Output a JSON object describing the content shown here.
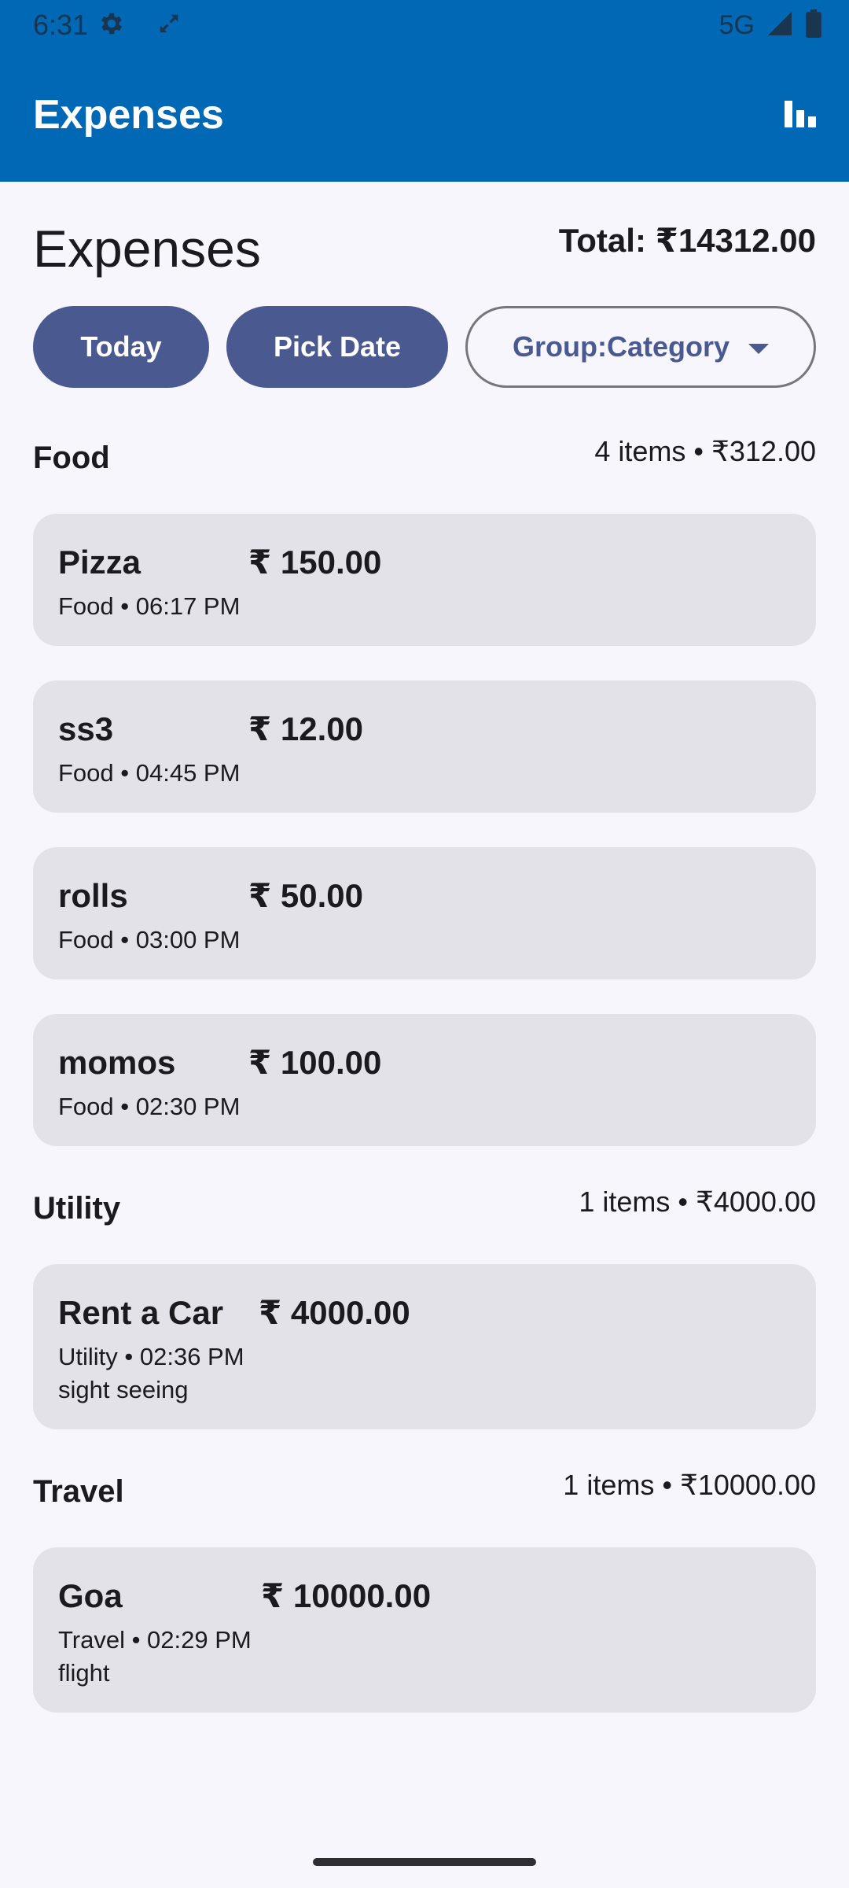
{
  "status_bar": {
    "time": "6:31",
    "network": "5G",
    "icons": [
      "settings-icon",
      "sync-icon",
      "signal-icon",
      "battery-icon"
    ]
  },
  "app_bar": {
    "title": "Expenses",
    "chart_icon": "bar-chart-icon"
  },
  "header": {
    "title": "Expenses",
    "total": "Total: ₹14312.00"
  },
  "filters": {
    "today_label": "Today",
    "pick_date_label": "Pick Date",
    "group_label": "Group:Category"
  },
  "groups": [
    {
      "name": "Food",
      "summary": "4 items • ₹312.00",
      "items": [
        {
          "name": "Pizza",
          "amount": "₹ 150.00",
          "meta": "Food • 06:17 PM"
        },
        {
          "name": "ss3",
          "amount": "₹ 12.00",
          "meta": "Food • 04:45 PM"
        },
        {
          "name": "rolls",
          "amount": "₹ 50.00",
          "meta": "Food • 03:00 PM"
        },
        {
          "name": "momos",
          "amount": "₹ 100.00",
          "meta": "Food • 02:30 PM"
        }
      ]
    },
    {
      "name": "Utility",
      "summary": "1 items • ₹4000.00",
      "items": [
        {
          "name": "Rent a Car",
          "amount": "₹ 4000.00",
          "meta": "Utility • 02:36 PM",
          "note": "sight seeing"
        }
      ]
    },
    {
      "name": "Travel",
      "summary": "1 items • ₹10000.00",
      "items": [
        {
          "name": "Goa",
          "amount": "₹ 10000.00",
          "meta": "Travel • 02:29 PM",
          "note": "flight"
        }
      ]
    }
  ],
  "colors": {
    "app_bar": "#0068B5",
    "background": "#F7F6FC",
    "card": "#E3E2E8",
    "button_fill": "#4A5A91",
    "outline": "#76767F"
  }
}
